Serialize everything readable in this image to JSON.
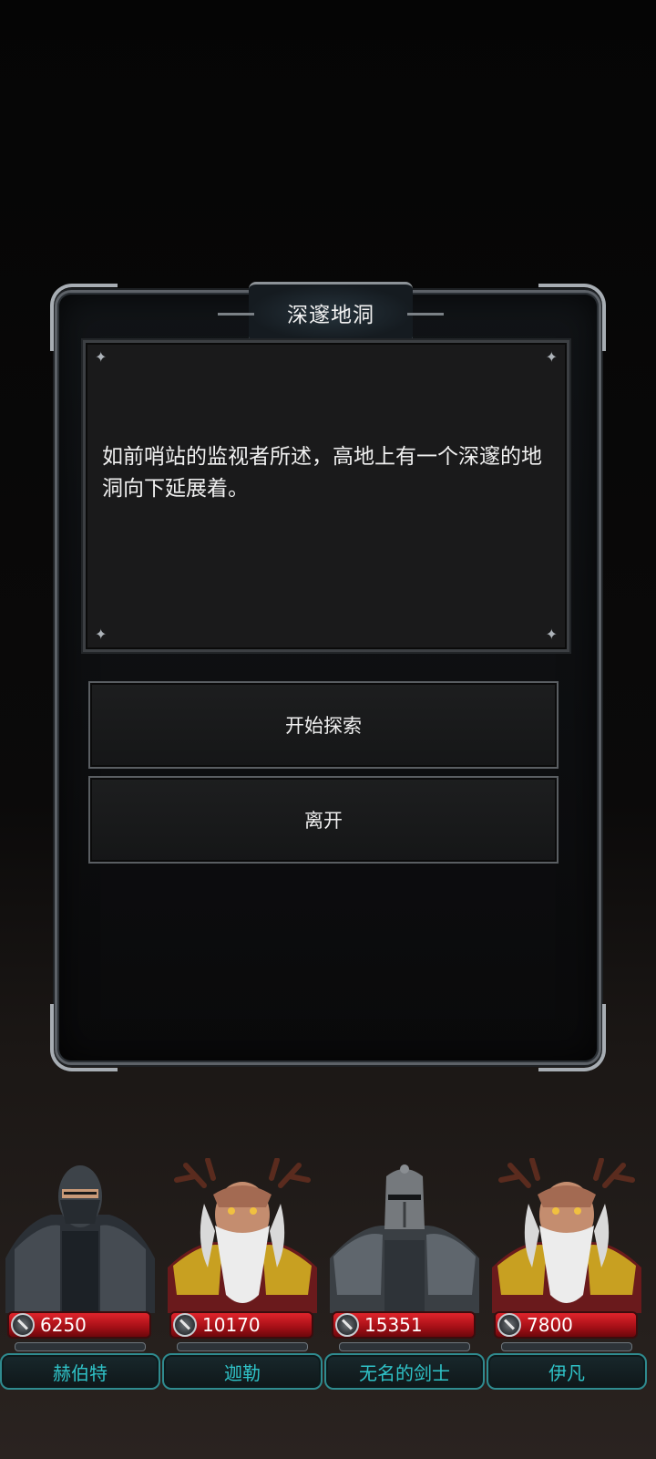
{
  "dialog": {
    "title": "深邃地洞",
    "description": "如前哨站的监视者所述，高地上有一个深邃的地洞向下延展着。",
    "options": [
      {
        "label": "开始探索"
      },
      {
        "label": "离开"
      }
    ]
  },
  "party": [
    {
      "name": "赫伯特",
      "hp": "6250",
      "portrait": "armored-knight-portrait"
    },
    {
      "name": "迦勒",
      "hp": "10170",
      "portrait": "antlered-elder-portrait"
    },
    {
      "name": "无名的剑士",
      "hp": "15351",
      "portrait": "helmed-swordsman-portrait"
    },
    {
      "name": "伊凡",
      "hp": "7800",
      "portrait": "antlered-elder-portrait"
    }
  ],
  "colors": {
    "hp_bar": "#c4161e",
    "name_text": "#2fc3c8",
    "frame": "#8c9297"
  }
}
